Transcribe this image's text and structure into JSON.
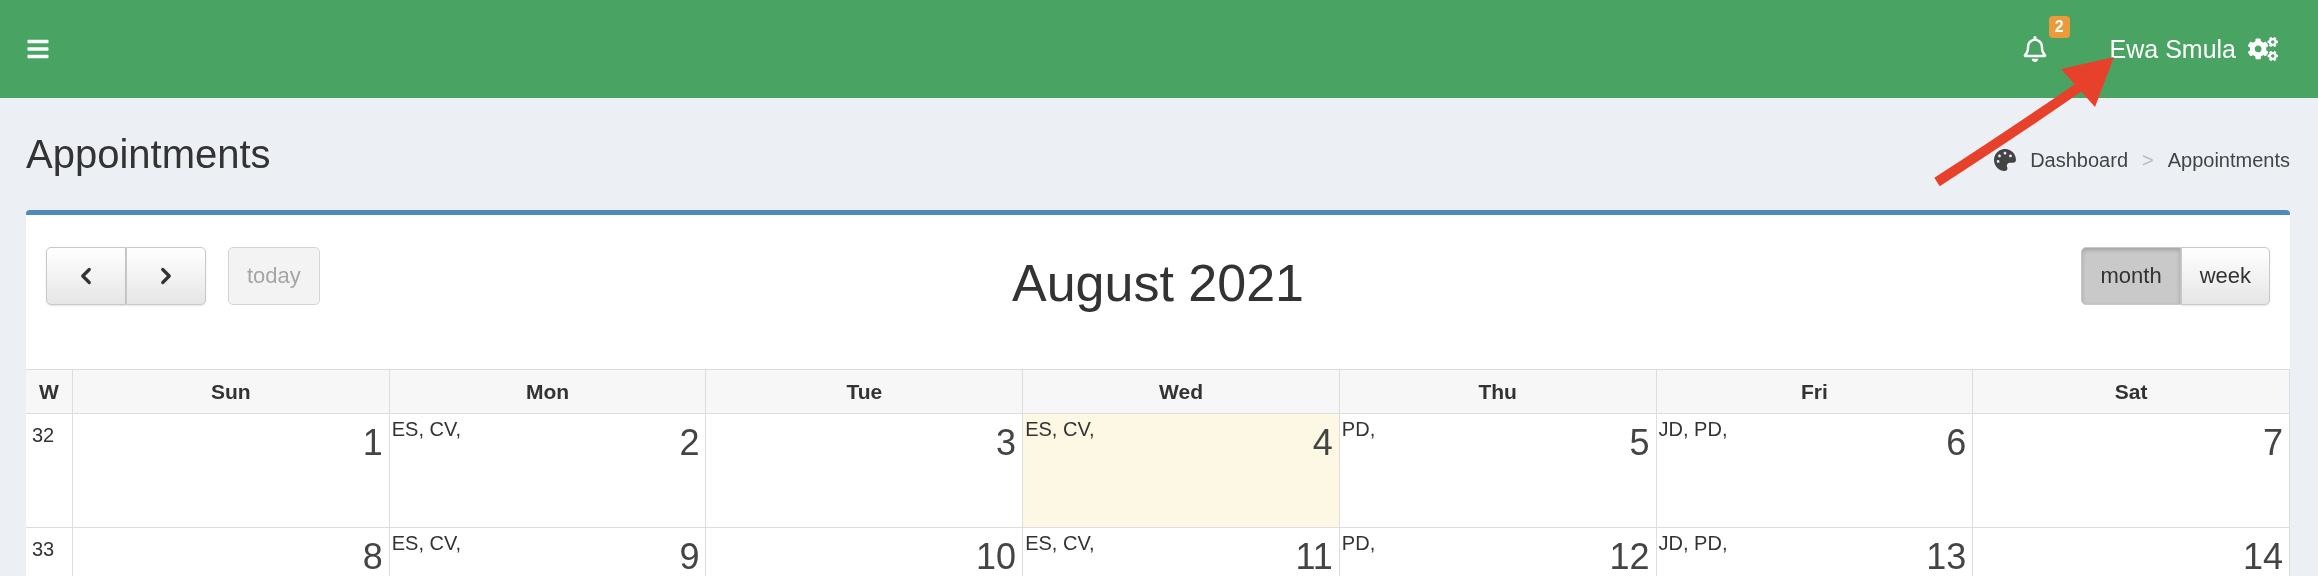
{
  "header": {
    "notification_count": "2",
    "user_name": "Ewa Smula"
  },
  "page_title": "Appointments",
  "breadcrumb": {
    "items": [
      {
        "label": "Dashboard"
      },
      {
        "label": "Appointments"
      }
    ],
    "separator": ">"
  },
  "calendar": {
    "today_button": {
      "label": "today",
      "disabled": true
    },
    "title": "August 2021",
    "views": [
      {
        "label": "month",
        "selected": true
      },
      {
        "label": "week",
        "selected": false
      }
    ],
    "week_heading": "W",
    "days": [
      "Sun",
      "Mon",
      "Tue",
      "Wed",
      "Thu",
      "Fri",
      "Sat"
    ],
    "weeks": [
      {
        "number": "32",
        "cells": [
          {
            "date": "1",
            "today": false
          },
          {
            "date": "2",
            "events": "ES, CV,",
            "today": false
          },
          {
            "date": "3",
            "today": false
          },
          {
            "date": "4",
            "events": "ES, CV,",
            "today": true
          },
          {
            "date": "5",
            "events": "PD,",
            "today": false
          },
          {
            "date": "6",
            "events": "JD, PD,",
            "today": false
          },
          {
            "date": "7",
            "today": false
          }
        ]
      },
      {
        "number": "33",
        "cells": [
          {
            "date": "8",
            "today": false
          },
          {
            "date": "9",
            "events": "ES, CV,",
            "today": false
          },
          {
            "date": "10",
            "today": false
          },
          {
            "date": "11",
            "events": "ES, CV,",
            "today": false
          },
          {
            "date": "12",
            "events": "PD,",
            "today": false
          },
          {
            "date": "13",
            "events": "JD, PD,",
            "today": false
          },
          {
            "date": "14",
            "today": false
          }
        ]
      }
    ]
  }
}
